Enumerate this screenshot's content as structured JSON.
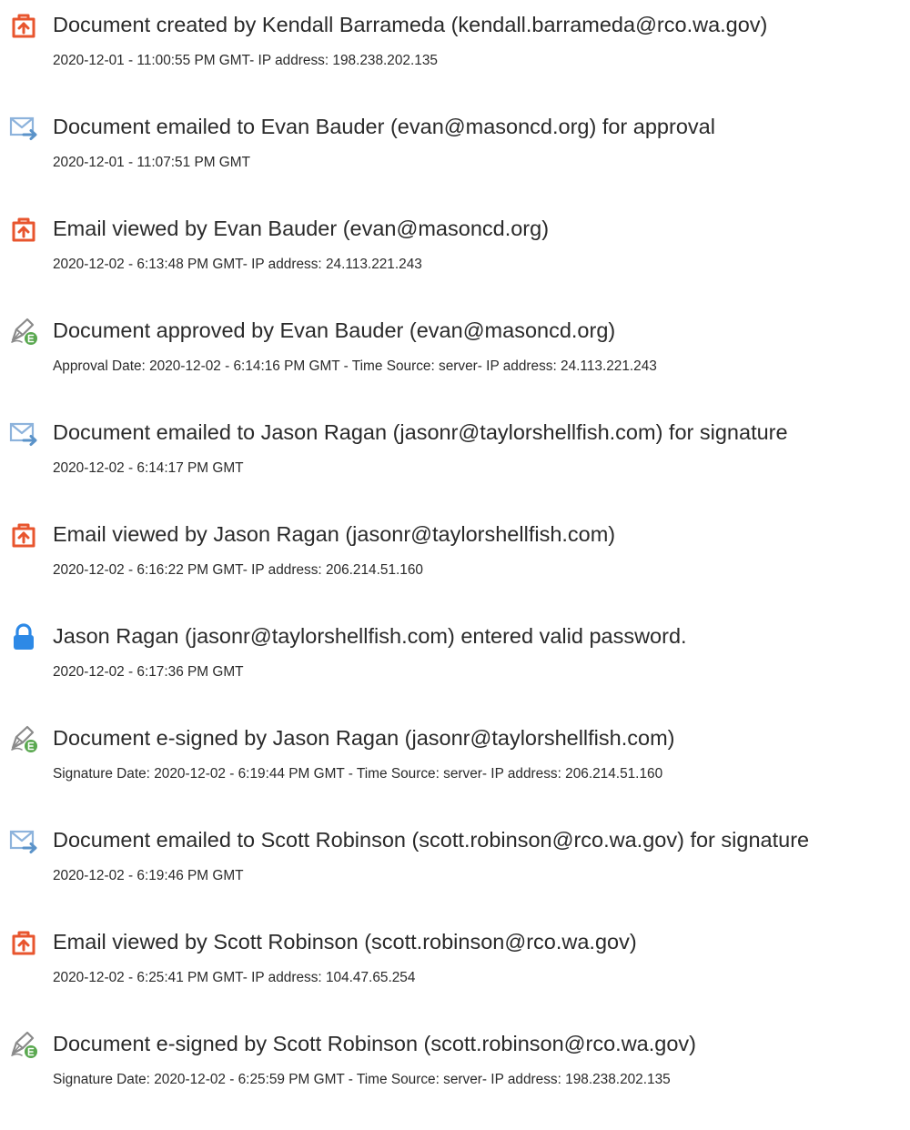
{
  "events": [
    {
      "icon": "document-created-icon",
      "title": "Document created by Kendall Barrameda (kendall.barrameda@rco.wa.gov)",
      "detail": "2020-12-01 - 11:00:55 PM GMT- IP address: 198.238.202.135"
    },
    {
      "icon": "email-sent-icon",
      "title": "Document emailed to Evan Bauder (evan@masoncd.org) for approval",
      "detail": "2020-12-01 - 11:07:51 PM GMT"
    },
    {
      "icon": "document-viewed-icon",
      "title": "Email viewed by Evan Bauder (evan@masoncd.org)",
      "detail": "2020-12-02 - 6:13:48 PM GMT- IP address: 24.113.221.243"
    },
    {
      "icon": "pen-sign-icon",
      "title": "Document approved by Evan Bauder (evan@masoncd.org)",
      "detail": "Approval Date: 2020-12-02 - 6:14:16 PM GMT - Time Source: server- IP address: 24.113.221.243"
    },
    {
      "icon": "email-sent-icon",
      "title": "Document emailed to Jason Ragan (jasonr@taylorshellfish.com) for signature",
      "detail": "2020-12-02 - 6:14:17 PM GMT"
    },
    {
      "icon": "document-viewed-icon",
      "title": "Email viewed by Jason Ragan (jasonr@taylorshellfish.com)",
      "detail": "2020-12-02 - 6:16:22 PM GMT- IP address: 206.214.51.160"
    },
    {
      "icon": "lock-icon",
      "title": "Jason Ragan (jasonr@taylorshellfish.com) entered valid password.",
      "detail": "2020-12-02 - 6:17:36 PM GMT"
    },
    {
      "icon": "pen-sign-icon",
      "title": "Document e-signed by Jason Ragan (jasonr@taylorshellfish.com)",
      "detail": "Signature Date: 2020-12-02 - 6:19:44 PM GMT - Time Source: server- IP address: 206.214.51.160"
    },
    {
      "icon": "email-sent-icon",
      "title": "Document emailed to Scott Robinson (scott.robinson@rco.wa.gov) for signature",
      "detail": "2020-12-02 - 6:19:46 PM GMT"
    },
    {
      "icon": "document-viewed-icon",
      "title": "Email viewed by Scott Robinson (scott.robinson@rco.wa.gov)",
      "detail": "2020-12-02 - 6:25:41 PM GMT- IP address: 104.47.65.254"
    },
    {
      "icon": "pen-sign-icon",
      "title": "Document e-signed by Scott Robinson (scott.robinson@rco.wa.gov)",
      "detail": "Signature Date: 2020-12-02 - 6:25:59 PM GMT - Time Source: server- IP address: 198.238.202.135"
    }
  ],
  "colors": {
    "acrobat_orange": "#e8552e",
    "email_blue": "#5b93c9",
    "lock_blue": "#2d89e6",
    "pen_green": "#5aa850",
    "text": "#2a2a2a"
  }
}
